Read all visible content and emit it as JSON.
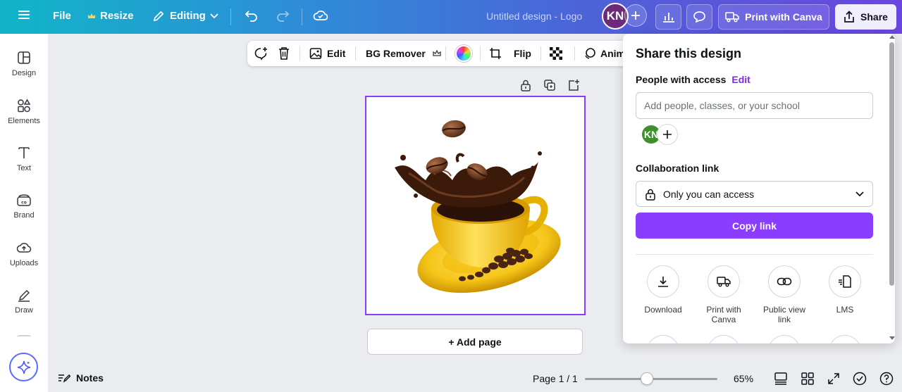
{
  "topbar": {
    "file": "File",
    "resize": "Resize",
    "mode": "Editing",
    "doc_title": "Untitled design - Logo",
    "avatar_initials": "KN",
    "print": "Print with Canva",
    "share": "Share"
  },
  "rail": {
    "items": [
      {
        "label": "Design",
        "icon": "layout-icon"
      },
      {
        "label": "Elements",
        "icon": "shapes-icon"
      },
      {
        "label": "Text",
        "icon": "text-icon"
      },
      {
        "label": "Brand",
        "icon": "brand-icon"
      },
      {
        "label": "Uploads",
        "icon": "cloud-upload-icon"
      },
      {
        "label": "Draw",
        "icon": "pen-icon"
      }
    ]
  },
  "context_toolbar": {
    "edit": "Edit",
    "bg_remover": "BG Remover",
    "flip": "Flip",
    "animate": "Anim"
  },
  "canvas": {
    "add_page": "+ Add page"
  },
  "bottom": {
    "notes": "Notes",
    "page": "Page 1 / 1",
    "zoom": "65%",
    "zoom_fraction": 0.65
  },
  "share_panel": {
    "title": "Share this design",
    "people_label": "People with access",
    "people_edit": "Edit",
    "add_placeholder": "Add people, classes, or your school",
    "avatar_initials": "KN",
    "collab_label": "Collaboration link",
    "access_value": "Only you can access",
    "copy_link": "Copy link",
    "options": [
      {
        "label": "Download",
        "icon": "download-icon"
      },
      {
        "label": "Print with Canva",
        "icon": "truck-icon"
      },
      {
        "label": "Public view link",
        "icon": "link-icon"
      },
      {
        "label": "LMS",
        "icon": "lms-icon"
      }
    ]
  },
  "colors": {
    "accent": "#8b3dff",
    "link": "#7d2ae8",
    "avatar_top": "#6b2a7a",
    "avatar_panel": "#3f8f2f"
  }
}
